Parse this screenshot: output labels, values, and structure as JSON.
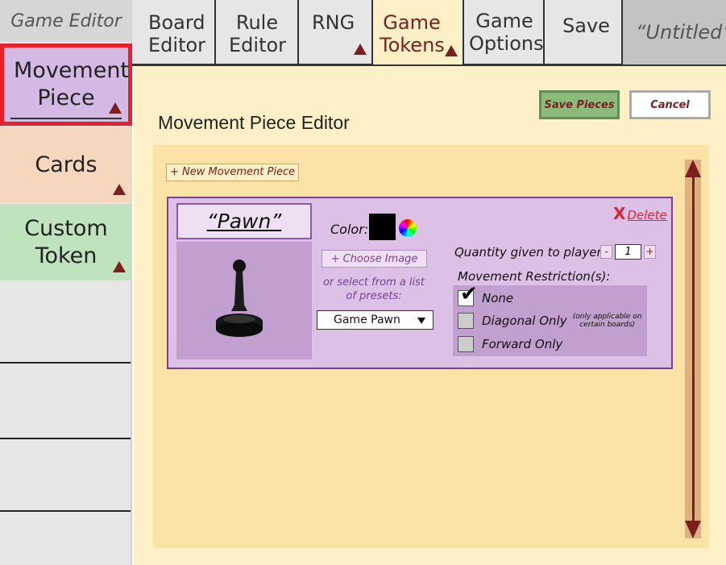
{
  "sidebar": {
    "title": "Game Editor",
    "items": [
      {
        "label": "Movement Piece"
      },
      {
        "label": "Cards"
      },
      {
        "label": "Custom Token"
      }
    ]
  },
  "tabs": [
    {
      "label": "Board Editor"
    },
    {
      "label": "Rule Editor"
    },
    {
      "label": "RNG"
    },
    {
      "label": "Game Tokens"
    },
    {
      "label": "Game Options"
    },
    {
      "label": "Save"
    },
    {
      "label": "“Untitled”"
    }
  ],
  "editor": {
    "title": "Movement Piece Editor",
    "save_label": "Save Pieces",
    "cancel_label": "Cancel",
    "new_piece_label": "+ New Movement Piece",
    "piece": {
      "name": "“Pawn”",
      "color_label": "Color:",
      "color": "#000000",
      "choose_image_label": "+ Choose Image",
      "presets_hint": "or select from a list of presets:",
      "preset_selected": "Game Pawn",
      "delete_label": "Delete",
      "quantity_label": "Quantity given to player:",
      "quantity_value": "1",
      "quantity_minus": "-",
      "quantity_plus": "+",
      "restriction_label": "Movement Restriction(s):",
      "restrictions": [
        {
          "label": "None",
          "checked": true
        },
        {
          "label": "Diagonal Only",
          "note": "(only applicable on certain boards)",
          "checked": false
        },
        {
          "label": "Forward Only",
          "checked": false
        }
      ]
    }
  },
  "colors": {
    "accent": "#7a2020",
    "selected_outline": "#e8202a",
    "movement_piece_bg": "#d3b9e3",
    "cards_bg": "#f6d6bd",
    "custom_token_bg": "#bee3bd",
    "content_bg": "#fdf0c7"
  },
  "icons": {
    "expand": "triangle-up-icon",
    "delete": "x-icon",
    "color_picker": "color-wheel-icon",
    "dropdown": "caret-down-icon"
  }
}
